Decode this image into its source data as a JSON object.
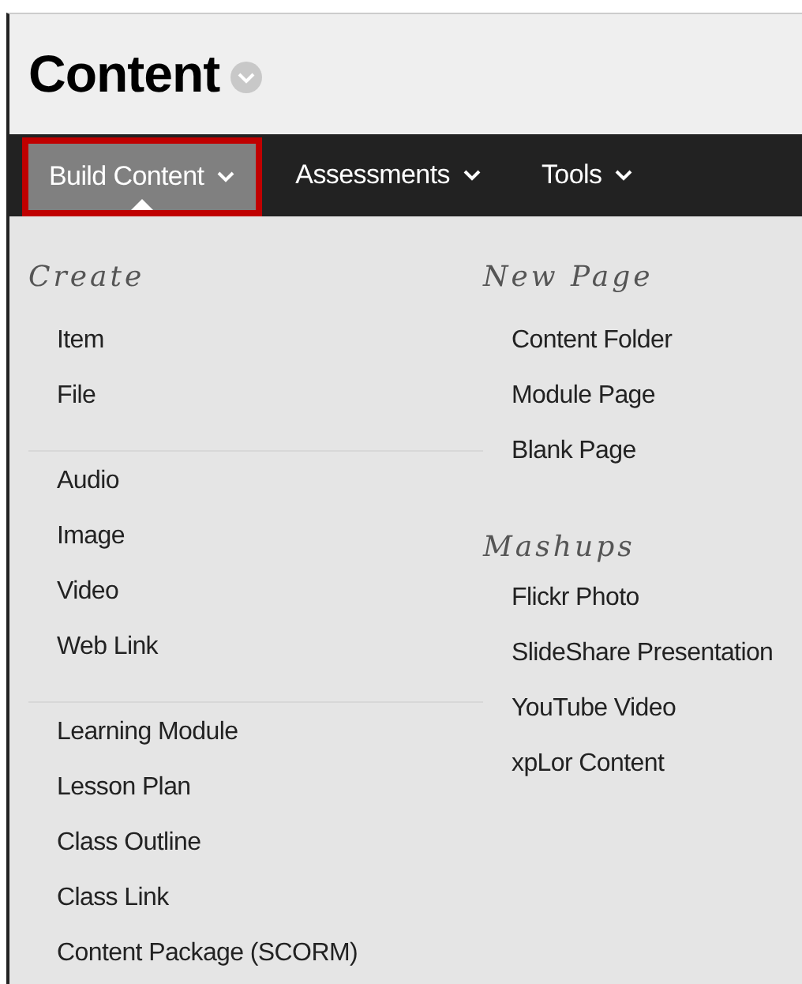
{
  "page": {
    "title": "Content"
  },
  "tabs": [
    {
      "label": "Build Content",
      "selected": true
    },
    {
      "label": "Assessments",
      "selected": false
    },
    {
      "label": "Tools",
      "selected": false
    }
  ],
  "menu": {
    "columns": [
      {
        "sections": [
          {
            "heading": "Create",
            "groups": [
              [
                "Item",
                "File"
              ],
              [
                "Audio",
                "Image",
                "Video",
                "Web Link"
              ],
              [
                "Learning Module",
                "Lesson Plan",
                "Class Outline",
                "Class Link",
                "Content Package (SCORM)"
              ]
            ]
          }
        ]
      },
      {
        "sections": [
          {
            "heading": "New Page",
            "groups": [
              [
                "Content Folder",
                "Module Page",
                "Blank Page"
              ]
            ]
          },
          {
            "heading": "Mashups",
            "groups": [
              [
                "Flickr Photo",
                "SlideShare Presentation",
                "YouTube Video",
                "xpLor Content"
              ]
            ]
          }
        ]
      }
    ]
  }
}
